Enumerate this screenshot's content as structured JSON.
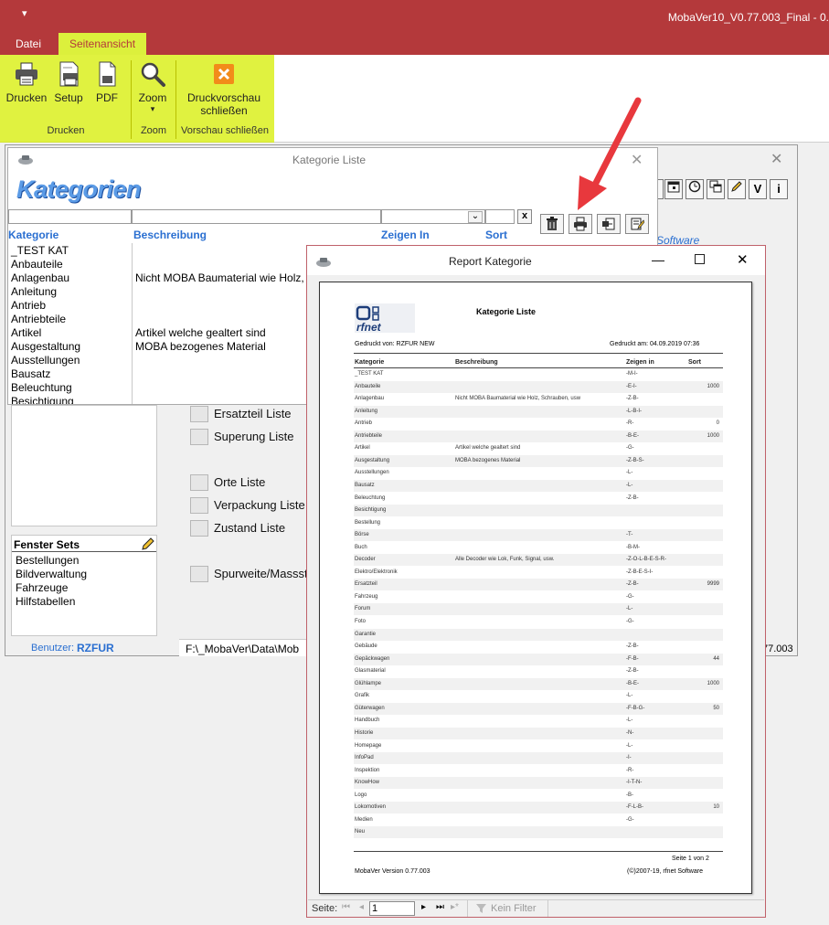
{
  "app": {
    "title": "MobaVer10_V0.77.003_Final - 0.",
    "qat_glyph": "▾"
  },
  "ribbon": {
    "tabs": [
      "Datei",
      "Seitenansicht"
    ],
    "buttons": {
      "drucken": "Drucken",
      "setup": "Setup",
      "pdf": "PDF",
      "zoom": "Zoom",
      "zoom_arrow": "▾",
      "druckvorschau_line1": "Druckvorschau",
      "druckvorschau_line2": "schließen"
    },
    "groups": {
      "drucken": "Drucken",
      "zoom": "Zoom",
      "vorschau": "Vorschau schließen"
    },
    "highlight_color": "#d6ee00",
    "accent": "#b4393b"
  },
  "main_window": {
    "toolbar_v": "V",
    "toolbar_i": "i",
    "software_link": "Software",
    "list_labels": [
      "Ersatzteil Liste",
      "Superung Liste",
      "Orte Liste",
      "Verpackung Liste",
      "Zustand Liste",
      "Spurweite/Massst"
    ],
    "fenster_sets_title": "Fenster Sets",
    "fenster_sets": [
      "Bestellungen",
      "Bildverwaltung",
      "Fahrzeuge",
      "Hilfstabellen"
    ],
    "benutzer_label": "Benutzer:",
    "benutzer_value": "RZFUR",
    "path": "F:\\_MobaVer\\Data\\Mob",
    "version_suffix": "77.003"
  },
  "kategorie_window": {
    "title": "Kategorie Liste",
    "banner": "Kategorien",
    "clear_btn": "x",
    "columns": {
      "kategorie": "Kategorie",
      "beschreibung": "Beschreibung",
      "zeigen_in": "Zeigen In",
      "sort": "Sort"
    },
    "items": [
      "_TEST KAT",
      "Anbauteile",
      "Anlagenbau",
      "Anleitung",
      "Antrieb",
      "Antriebteile",
      "Artikel",
      "Ausgestaltung",
      "Ausstellungen",
      "Bausatz",
      "Beleuchtung",
      "Besichtigung"
    ],
    "descriptions": [
      {
        "row": 2,
        "text": "Nicht MOBA Baumaterial wie Holz,"
      },
      {
        "row": 6,
        "text": "Artikel welche gealtert sind"
      },
      {
        "row": 7,
        "text": "MOBA bezogenes Material"
      }
    ]
  },
  "report_window": {
    "title": "Report Kategorie",
    "paper": {
      "logo_text": "rfnet",
      "title": "Kategorie Liste",
      "printed_by": "Gedruckt von:  RZFUR NEW",
      "printed_at": "Gedruckt am:  04.09.2019 07:36",
      "columns": [
        "Kategorie",
        "Beschreibung",
        "Zeigen in",
        "Sort"
      ],
      "rows": [
        [
          "_TEST KAT",
          "",
          "-M-I-",
          ""
        ],
        [
          "Anbauteile",
          "",
          "-E-I-",
          "1000"
        ],
        [
          "Anlagenbau",
          "Nicht MOBA Baumaterial wie Holz, Schrauben, usw",
          "-Z-B-",
          ""
        ],
        [
          "Anleitung",
          "",
          "-L-B-I-",
          ""
        ],
        [
          "Antrieb",
          "",
          "-R-",
          "0"
        ],
        [
          "Antriebteile",
          "",
          "-B-E-",
          "1000"
        ],
        [
          "Artikel",
          "Artikel welche gealtert sind",
          "-G-",
          ""
        ],
        [
          "Ausgestaltung",
          "MOBA bezogenes Material",
          "-Z-B-S-",
          ""
        ],
        [
          "Ausstellungen",
          "",
          "-L-",
          ""
        ],
        [
          "Bausatz",
          "",
          "-L-",
          ""
        ],
        [
          "Beleuchtung",
          "",
          "-Z-B-",
          ""
        ],
        [
          "Besichtigung",
          "",
          "",
          ""
        ],
        [
          "Bestellung",
          "",
          "",
          ""
        ],
        [
          "Börse",
          "",
          "-T-",
          ""
        ],
        [
          "Buch",
          "",
          "-B-M-",
          ""
        ],
        [
          "Decoder",
          "Alle Decoder wie Lok, Funk, Signal, usw.",
          "-Z-O-L-B-E-S-R-",
          ""
        ],
        [
          "Elektro/Elektronik",
          "",
          "-Z-B-E-S-I-",
          ""
        ],
        [
          "Ersatzteil",
          "",
          "-Z-B-",
          "9999"
        ],
        [
          "Fahrzeug",
          "",
          "-G-",
          ""
        ],
        [
          "Forum",
          "",
          "-L-",
          ""
        ],
        [
          "Foto",
          "",
          "-G-",
          ""
        ],
        [
          "Garantie",
          "",
          "",
          ""
        ],
        [
          "Gebäude",
          "",
          "-Z-B-",
          ""
        ],
        [
          "Gepäckwagen",
          "",
          "-F-B-",
          "44"
        ],
        [
          "Glasmaterial",
          "",
          "-Z-B-",
          ""
        ],
        [
          "Glühlampe",
          "",
          "-B-E-",
          "1000"
        ],
        [
          "Grafik",
          "",
          "-L-",
          ""
        ],
        [
          "Güterwagen",
          "",
          "-F-B-G-",
          "50"
        ],
        [
          "Handbuch",
          "",
          "-L-",
          ""
        ],
        [
          "Historie",
          "",
          "-N-",
          ""
        ],
        [
          "Homepage",
          "",
          "-L-",
          ""
        ],
        [
          "InfoPad",
          "",
          "-I-",
          ""
        ],
        [
          "Inspektion",
          "",
          "-R-",
          ""
        ],
        [
          "KnowHow",
          "",
          "-I-T-N-",
          ""
        ],
        [
          "Logo",
          "",
          "-B-",
          ""
        ],
        [
          "Lokomotiven",
          "",
          "-F-L-B-",
          "10"
        ],
        [
          "Medien",
          "",
          "-G-",
          ""
        ],
        [
          "Neu",
          "",
          "",
          ""
        ]
      ],
      "page_of": "Seite 1 von 2",
      "footer_version": "MobaVer Version 0.77.003",
      "footer_copyright": "(©)2007-19, rfnet Software"
    },
    "nav": {
      "label": "Seite:",
      "page": "1",
      "filter": "Kein Filter"
    }
  }
}
